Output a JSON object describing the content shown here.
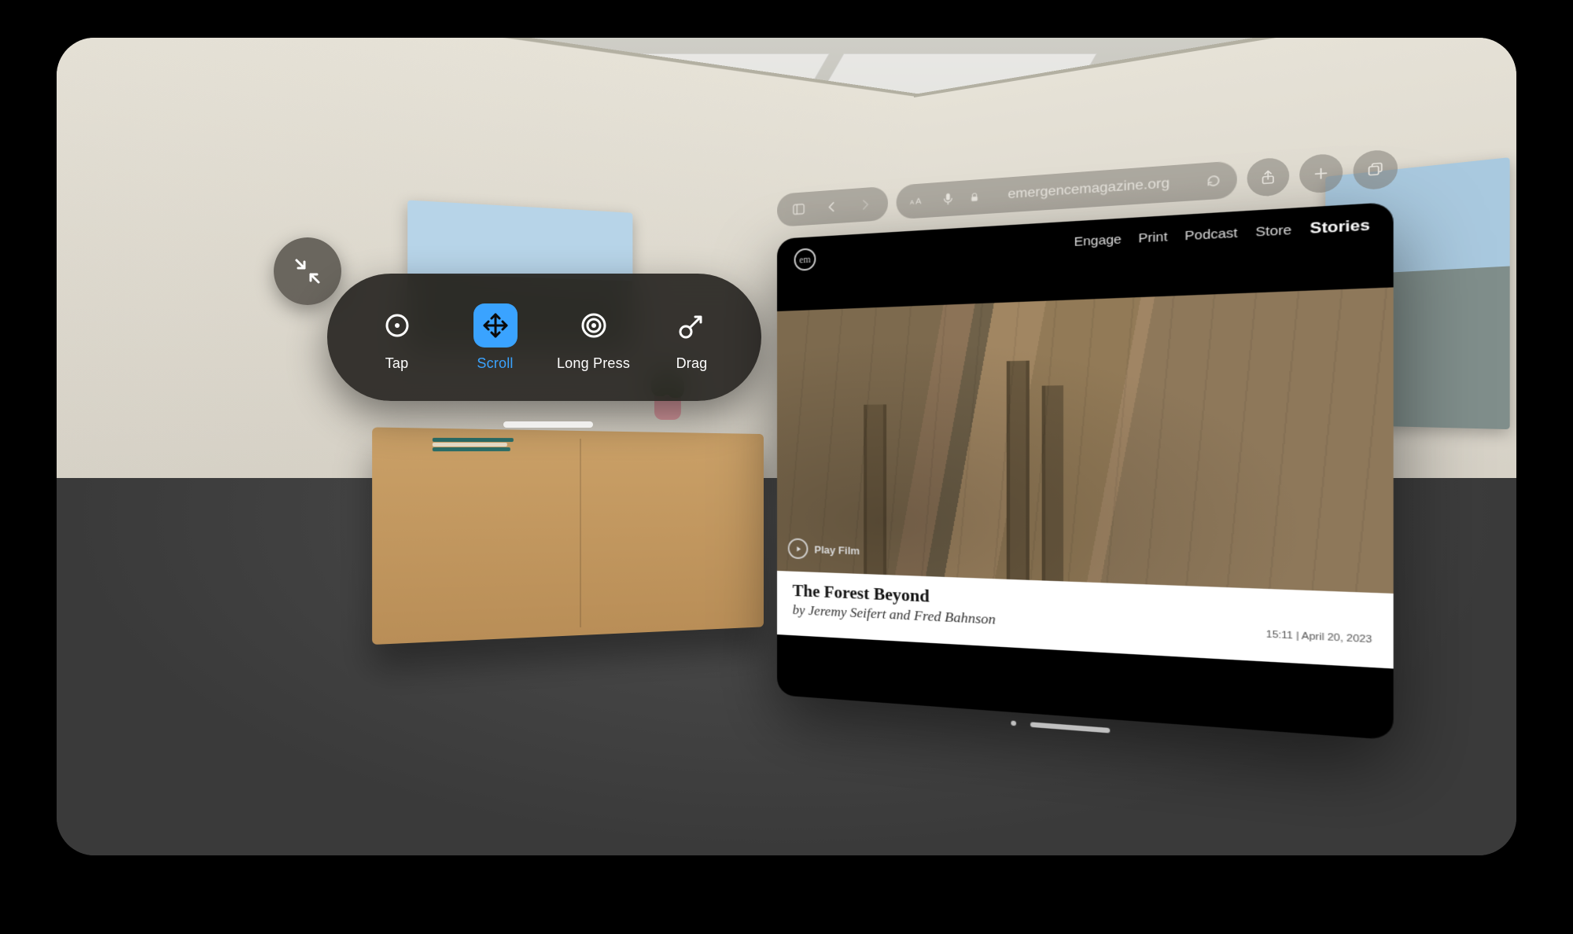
{
  "pointer_control": {
    "items": [
      {
        "id": "tap",
        "label": "Tap"
      },
      {
        "id": "scroll",
        "label": "Scroll"
      },
      {
        "id": "long_press",
        "label": "Long Press"
      },
      {
        "id": "drag",
        "label": "Drag"
      }
    ],
    "selected": "scroll"
  },
  "safari": {
    "address": "emergencemagazine.org",
    "nav": {
      "engage": "Engage",
      "print": "Print",
      "podcast": "Podcast",
      "store": "Store",
      "stories": "Stories"
    },
    "play_label": "Play Film",
    "story_title": "The Forest Beyond",
    "byline": "by Jeremy Seifert and Fred Bahnson",
    "duration": "15:11",
    "date": "April 20, 2023",
    "meta_separator": "  |  "
  }
}
